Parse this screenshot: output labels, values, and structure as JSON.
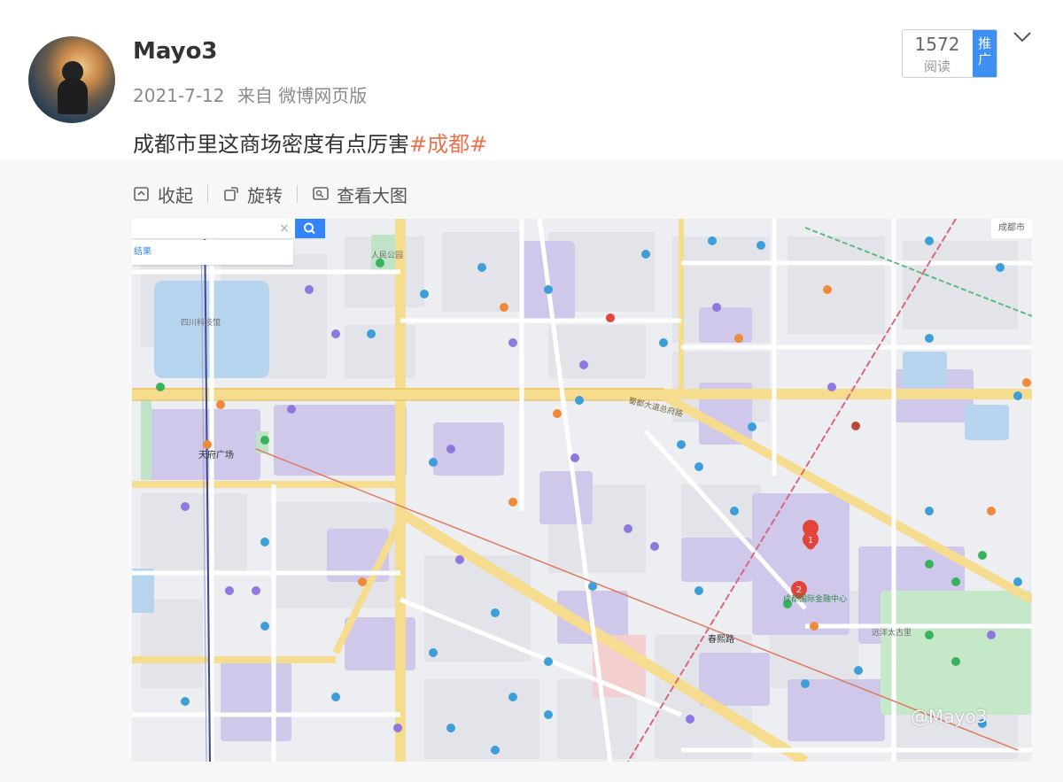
{
  "post": {
    "username": "Mayo3",
    "date": "2021-7-12",
    "source": "来自 微博网页版",
    "text_main": "成都市里这商场密度有点厉害",
    "hashtag": "#成都#",
    "read_count": "1572",
    "read_label": "阅读",
    "promo_label": "推广"
  },
  "toolbar": {
    "collapse": "收起",
    "rotate": "旋转",
    "view_large": "查看大图"
  },
  "map": {
    "search_clear": "×",
    "search_hint": "结果",
    "corner_tag": "成都市",
    "watermark": "@Mayo3",
    "labels": {
      "tianfu": "天府广场",
      "chunxi": "春熙路",
      "road_shudu": "蜀都大道总府路",
      "ifs_label": "成都国际金融中心",
      "taikooli": "远洋太古里",
      "sichuan_museum": "四川科技馆",
      "renmin_park": "人民公园",
      "marker1": "1",
      "marker2": "2"
    }
  },
  "colors": {
    "accent": "#eb7350",
    "promo": "#3d8ff1",
    "search": "#3385ff",
    "marker": "#e2433b"
  }
}
